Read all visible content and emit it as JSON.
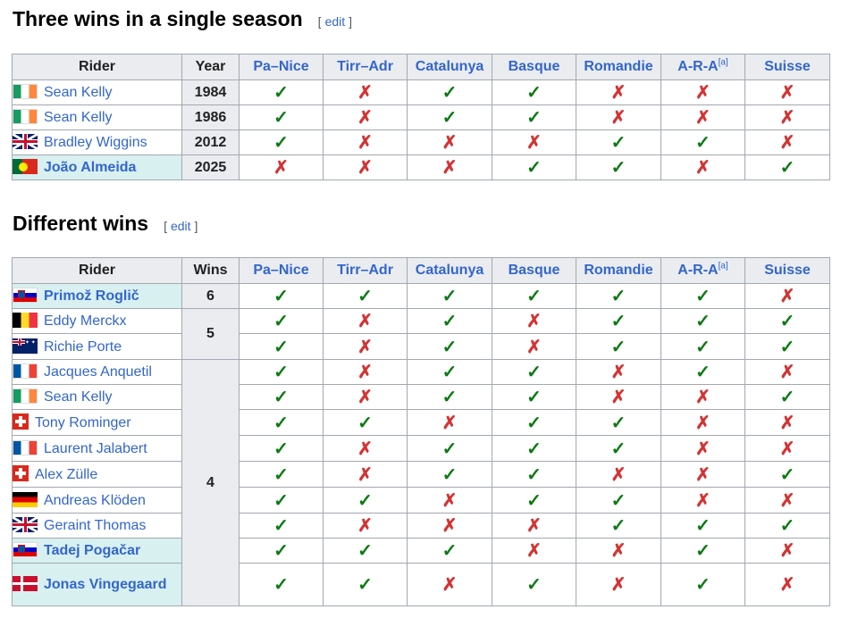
{
  "sections": [
    {
      "title": "Three wins in a single season",
      "edit_label": "edit",
      "columns": [
        "Rider",
        "Year",
        "Pa–Nice",
        "Tirr–Adr",
        "Catalunya",
        "Basque",
        "Romandie",
        "A-R-A",
        "Suisse"
      ],
      "footnote_mark": "[a]",
      "rows": [
        {
          "rider": "Sean Kelly",
          "flag": "ireland-flag",
          "value": "1984",
          "results": [
            "✓",
            "✗",
            "✓",
            "✓",
            "✗",
            "✗",
            "✗"
          ]
        },
        {
          "rider": "Sean Kelly",
          "flag": "ireland-flag",
          "value": "1986",
          "results": [
            "✓",
            "✗",
            "✓",
            "✓",
            "✗",
            "✗",
            "✗"
          ]
        },
        {
          "rider": "Bradley Wiggins",
          "flag": "uk-flag",
          "value": "2012",
          "results": [
            "✓",
            "✗",
            "✗",
            "✗",
            "✓",
            "✓",
            "✗"
          ]
        },
        {
          "rider": "João Almeida",
          "flag": "portugal-flag",
          "value": "2025",
          "results": [
            "✗",
            "✗",
            "✗",
            "✓",
            "✓",
            "✗",
            "✓"
          ]
        }
      ]
    },
    {
      "title": "Different wins",
      "edit_label": "edit",
      "columns": [
        "Rider",
        "Wins",
        "Pa–Nice",
        "Tirr–Adr",
        "Catalunya",
        "Basque",
        "Romandie",
        "A-R-A",
        "Suisse"
      ],
      "footnote_mark": "[a]",
      "wins_groups": [
        "6",
        "5",
        "4"
      ],
      "rows": [
        {
          "rider": "Primož Roglič",
          "flag": "slovenia-flag",
          "results": [
            "✓",
            "✓",
            "✓",
            "✓",
            "✓",
            "✓",
            "✗"
          ]
        },
        {
          "rider": "Eddy Merckx",
          "flag": "belgium-flag",
          "results": [
            "✓",
            "✗",
            "✓",
            "✗",
            "✓",
            "✓",
            "✓"
          ]
        },
        {
          "rider": "Richie Porte",
          "flag": "australia-flag",
          "results": [
            "✓",
            "✗",
            "✓",
            "✗",
            "✓",
            "✓",
            "✓"
          ]
        },
        {
          "rider": "Jacques Anquetil",
          "flag": "france-flag",
          "results": [
            "✓",
            "✗",
            "✓",
            "✓",
            "✗",
            "✓",
            "✗"
          ]
        },
        {
          "rider": "Sean Kelly",
          "flag": "ireland-flag",
          "results": [
            "✓",
            "✗",
            "✓",
            "✓",
            "✗",
            "✗",
            "✓"
          ]
        },
        {
          "rider": "Tony Rominger",
          "flag": "switzerland-flag",
          "results": [
            "✓",
            "✓",
            "✗",
            "✓",
            "✓",
            "✗",
            "✗"
          ]
        },
        {
          "rider": "Laurent Jalabert",
          "flag": "france-flag",
          "results": [
            "✓",
            "✗",
            "✓",
            "✓",
            "✓",
            "✗",
            "✗"
          ]
        },
        {
          "rider": "Alex Zülle",
          "flag": "switzerland-flag",
          "results": [
            "✓",
            "✗",
            "✓",
            "✓",
            "✗",
            "✗",
            "✓"
          ]
        },
        {
          "rider": "Andreas Klöden",
          "flag": "germany-flag",
          "results": [
            "✓",
            "✓",
            "✗",
            "✓",
            "✓",
            "✗",
            "✗"
          ]
        },
        {
          "rider": "Geraint Thomas",
          "flag": "uk-flag",
          "results": [
            "✓",
            "✗",
            "✗",
            "✗",
            "✓",
            "✓",
            "✓"
          ]
        },
        {
          "rider": "Tadej Pogačar",
          "flag": "slovenia-flag",
          "results": [
            "✓",
            "✓",
            "✓",
            "✗",
            "✗",
            "✓",
            "✗"
          ]
        },
        {
          "rider": "Jonas Vingegaard",
          "flag": "denmark-flag",
          "results": [
            "✓",
            "✓",
            "✗",
            "✓",
            "✗",
            "✓",
            "✗"
          ]
        }
      ]
    }
  ],
  "colors": {
    "check": "#0b7a12",
    "cross": "#d33333",
    "link": "#3366cc",
    "highlight": "#d8f0f0",
    "header": "#eaecf0"
  }
}
